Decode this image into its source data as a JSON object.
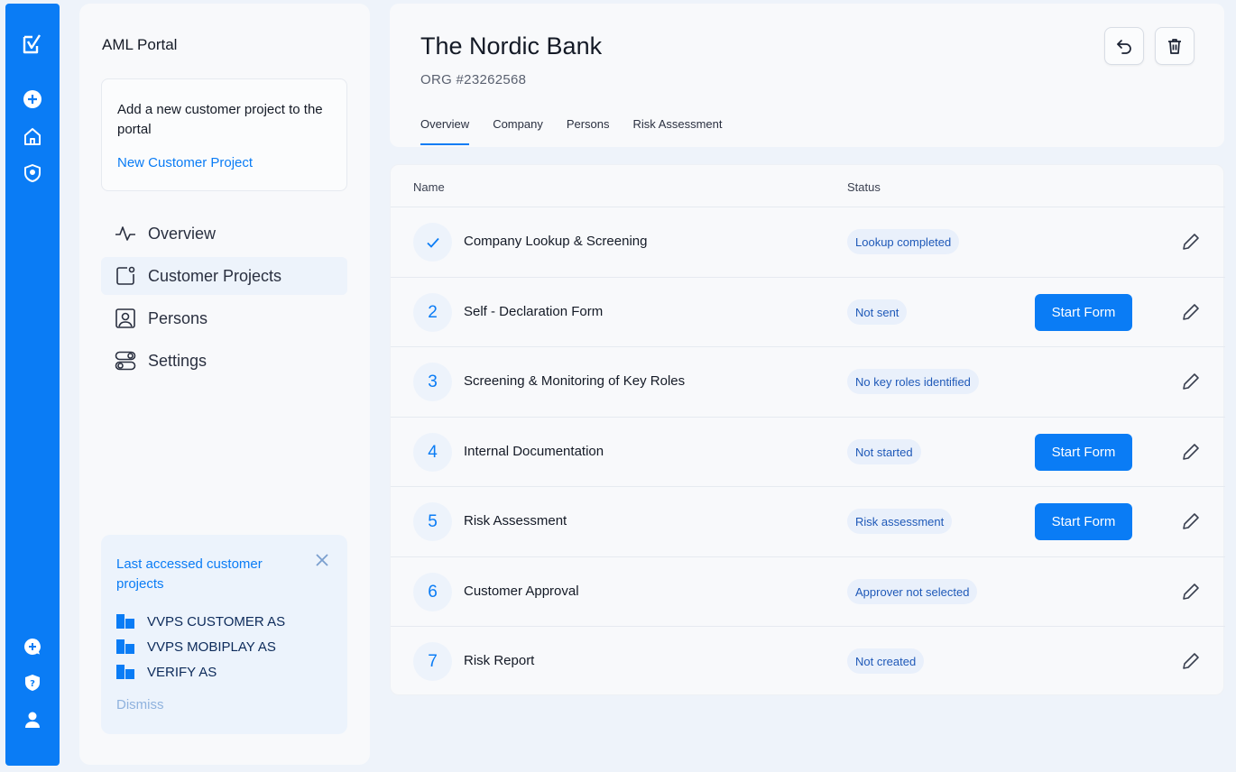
{
  "app": {
    "title": "AML Portal"
  },
  "promo": {
    "text": "Add a new customer project to the portal",
    "link": "New Customer Project"
  },
  "nav": {
    "items": [
      {
        "label": "Overview",
        "icon": "activity-icon"
      },
      {
        "label": "Customer Projects",
        "icon": "projects-icon",
        "active": true
      },
      {
        "label": "Persons",
        "icon": "person-card-icon"
      },
      {
        "label": "Settings",
        "icon": "toggles-icon"
      }
    ]
  },
  "recent": {
    "title": "Last accessed customer projects",
    "items": [
      "VVPS CUSTOMER AS",
      "VVPS MOBIPLAY AS",
      "VERIFY AS"
    ],
    "dismiss": "Dismiss"
  },
  "org": {
    "name": "The Nordic Bank",
    "number": "ORG #23262568"
  },
  "tabs": [
    "Overview",
    "Company",
    "Persons",
    "Risk Assessment"
  ],
  "table": {
    "headers": {
      "name": "Name",
      "status": "Status"
    },
    "rows": [
      {
        "step": "✓",
        "name": "Company Lookup & Screening",
        "status": "Lookup completed",
        "action": ""
      },
      {
        "step": "2",
        "name": "Self - Declaration Form",
        "status": "Not sent",
        "action": "Start Form"
      },
      {
        "step": "3",
        "name": "Screening & Monitoring of Key Roles",
        "status": "No key roles identified",
        "action": ""
      },
      {
        "step": "4",
        "name": "Internal Documentation",
        "status": "Not started",
        "action": "Start Form"
      },
      {
        "step": "5",
        "name": "Risk Assessment",
        "status": "Risk assessment",
        "action": "Start Form"
      },
      {
        "step": "6",
        "name": "Customer Approval",
        "status": "Approver not selected",
        "action": ""
      },
      {
        "step": "7",
        "name": "Risk Report",
        "status": "Not created",
        "action": ""
      }
    ]
  },
  "colors": {
    "accent": "#0a7cf5",
    "badge_bg": "#e9f0fb",
    "badge_text": "#1f59b8"
  }
}
